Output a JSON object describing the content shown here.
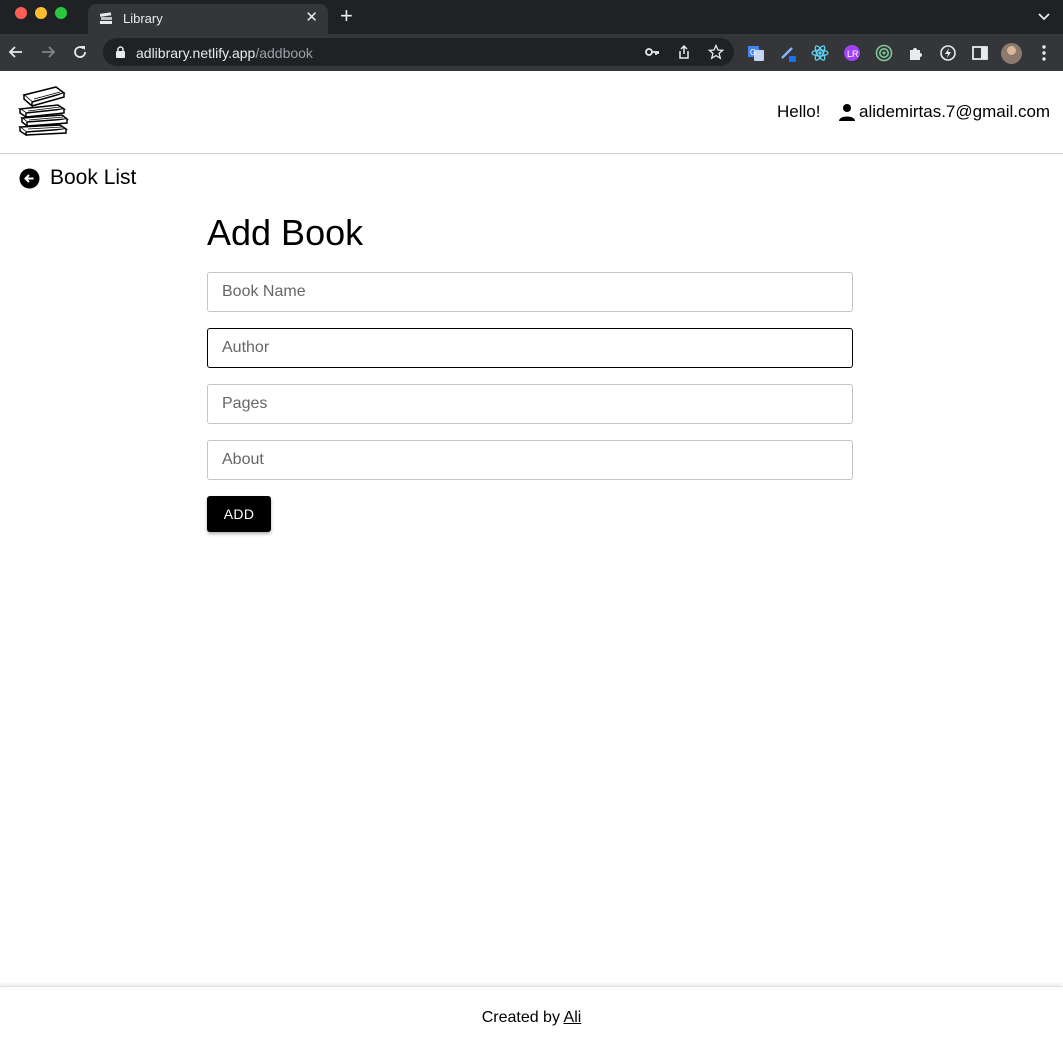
{
  "browser": {
    "tab_title": "Library",
    "tab_close": "✕",
    "new_tab": "+",
    "url_host": "adlibrary.netlify.app",
    "url_path": "/addbook"
  },
  "header": {
    "greeting": "Hello!",
    "user_email": "alidemirtas.7@gmail.com"
  },
  "nav": {
    "back_label": "Book List"
  },
  "form": {
    "title": "Add Book",
    "book_name_placeholder": "Book Name",
    "author_placeholder": "Author",
    "pages_placeholder": "Pages",
    "about_placeholder": "About",
    "submit_label": "ADD"
  },
  "footer": {
    "prefix": "Created by",
    "author_link": "Ali"
  },
  "colors": {
    "chrome_dark": "#202124",
    "chrome_toolbar": "#35363a",
    "button_bg": "#000000",
    "accent_text": "#000000"
  }
}
